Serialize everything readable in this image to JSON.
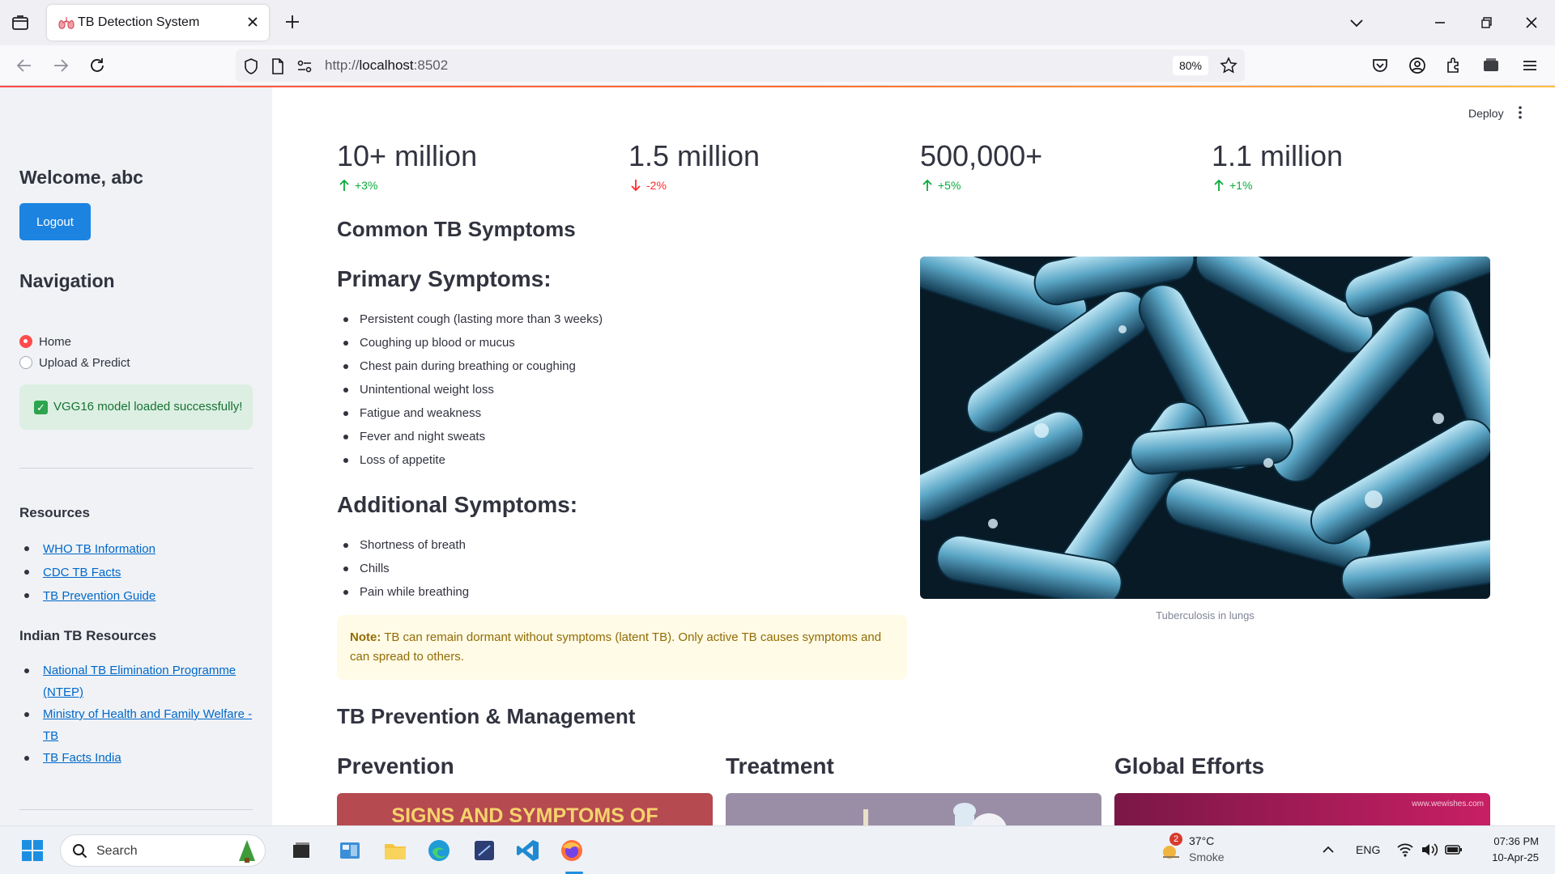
{
  "browser": {
    "tab_title": "TB Detection System",
    "url_prefix": "http://",
    "url_host": "localhost",
    "url_port": ":8502",
    "zoom": "80%"
  },
  "sidebar": {
    "welcome": "Welcome, abc",
    "logout_label": "Logout",
    "navigation_heading": "Navigation",
    "nav_options": [
      {
        "label": "Home",
        "selected": true
      },
      {
        "label": "Upload & Predict",
        "selected": false
      }
    ],
    "status_message": "VGG16 model loaded successfully!",
    "resources_heading": "Resources",
    "resources_links": [
      "WHO TB Information",
      "CDC TB Facts",
      "TB Prevention Guide"
    ],
    "indian_heading": "Indian TB Resources",
    "indian_links": [
      [
        "National TB Elimination Programme",
        "(NTEP)"
      ],
      [
        "Ministry of Health and Family Welfare -",
        "TB"
      ],
      [
        "TB Facts India"
      ]
    ]
  },
  "header": {
    "deploy_label": "Deploy"
  },
  "metrics": [
    {
      "value": "10+ million",
      "delta": "+3%",
      "direction": "up"
    },
    {
      "value": "1.5 million",
      "delta": "-2%",
      "direction": "down"
    },
    {
      "value": "500,000+",
      "delta": "+5%",
      "direction": "up"
    },
    {
      "value": "1.1 million",
      "delta": "+1%",
      "direction": "up"
    }
  ],
  "symptoms": {
    "heading": "Common TB Symptoms",
    "primary_heading": "Primary Symptoms:",
    "primary_list": [
      "Persistent cough (lasting more than 3 weeks)",
      "Coughing up blood or mucus",
      "Chest pain during breathing or coughing",
      "Unintentional weight loss",
      "Fatigue and weakness",
      "Fever and night sweats",
      "Loss of appetite"
    ],
    "additional_heading": "Additional Symptoms:",
    "additional_list": [
      "Shortness of breath",
      "Chills",
      "Pain while breathing"
    ],
    "note_label": "Note:",
    "note_text": " TB can remain dormant without symptoms (latent TB). Only active TB causes symptoms and can spread to others.",
    "image_caption": "Tuberculosis in lungs"
  },
  "prevention": {
    "heading": "TB Prevention & Management",
    "columns": [
      "Prevention",
      "Treatment",
      "Global Efforts"
    ],
    "card1_text": "SIGNS AND SYMPTOMS OF",
    "card3_watermark": "www.wewishes.com"
  },
  "taskbar": {
    "search_label": "Search",
    "weather_badge": "2",
    "temperature": "37°C",
    "weather": "Smoke",
    "language": "ENG",
    "time": "07:36 PM",
    "date": "10-Apr-25"
  },
  "colors": {
    "accent": "#ff4b4b",
    "button_blue": "#1c83e1",
    "link": "#0068c9",
    "delta_up": "#09ab3b",
    "delta_down": "#ff2b2b"
  }
}
